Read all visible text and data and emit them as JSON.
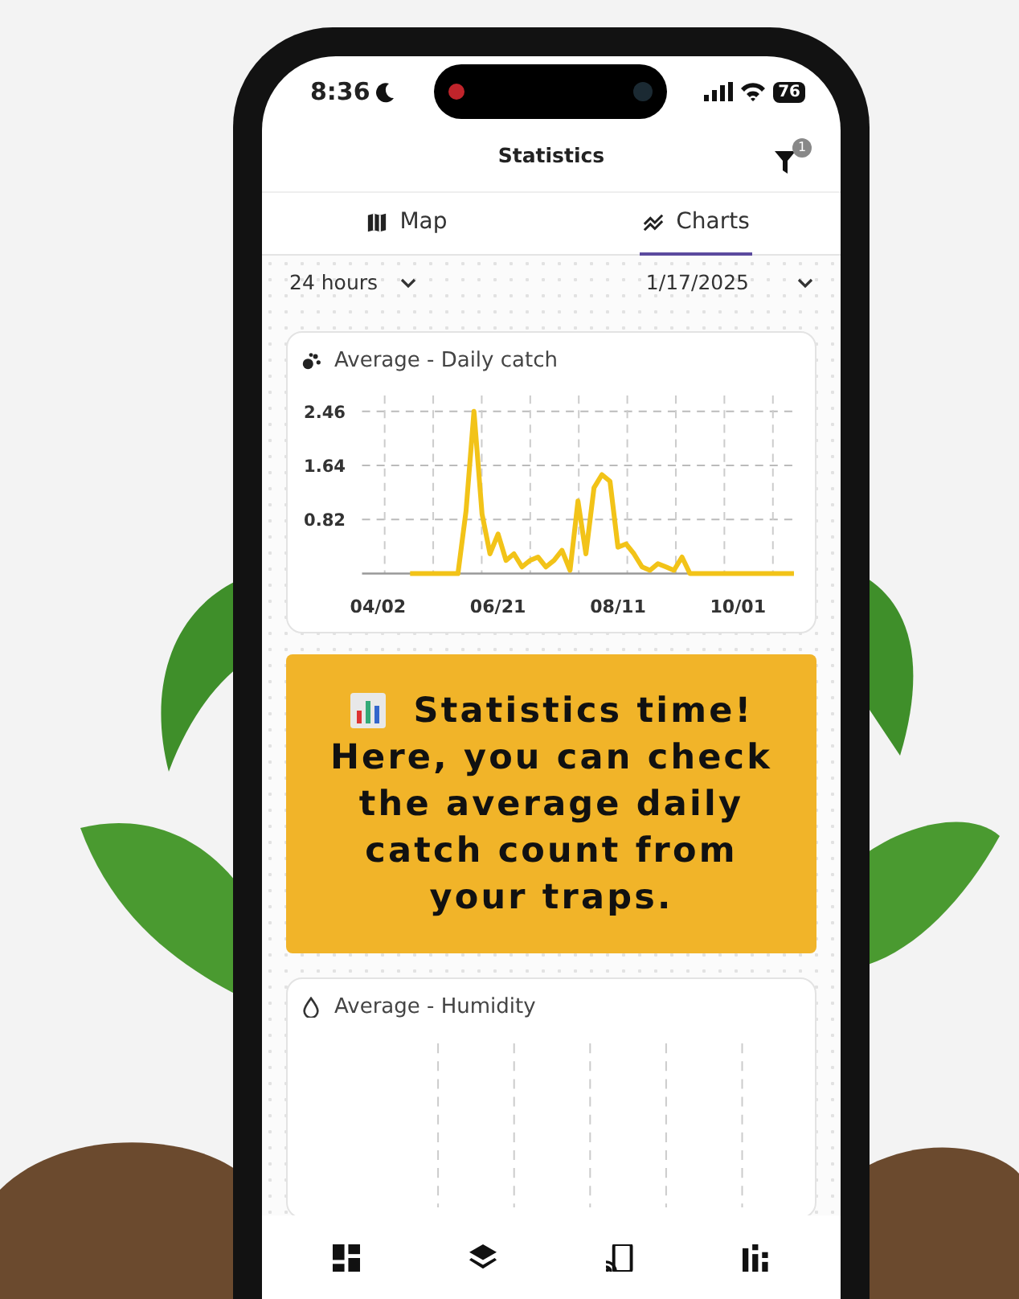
{
  "status_bar": {
    "time": "8:36",
    "battery": "76"
  },
  "header": {
    "title": "Statistics",
    "filter_badge": "1"
  },
  "tabs": [
    {
      "label": "Map",
      "selected": false
    },
    {
      "label": "Charts",
      "selected": true
    }
  ],
  "filters": {
    "period": "24 hours",
    "date": "1/17/2025"
  },
  "charts": [
    {
      "title": "Average - Daily catch",
      "chart_data": {
        "type": "line",
        "categories": [
          null,
          null,
          "04/02",
          null,
          null,
          null,
          null,
          null,
          null,
          null,
          null,
          null,
          null,
          null,
          null,
          null,
          null,
          "06/21",
          null,
          null,
          null,
          null,
          null,
          null,
          null,
          null,
          null,
          null,
          null,
          null,
          null,
          null,
          "08/11",
          null,
          null,
          null,
          null,
          null,
          null,
          null,
          null,
          null,
          null,
          null,
          null,
          null,
          null,
          "10/01",
          null,
          null,
          null,
          null,
          null,
          null,
          null
        ],
        "series": [
          {
            "color": "#f2c318",
            "values": [
              null,
              null,
              null,
              null,
              null,
              null,
              0,
              0,
              0,
              0,
              0,
              0,
              0,
              0.95,
              2.46,
              0.9,
              0.3,
              0.6,
              0.2,
              0.3,
              0.1,
              0.2,
              0.25,
              0.1,
              0.2,
              0.35,
              0.05,
              1.1,
              0.3,
              1.3,
              1.5,
              1.4,
              0.4,
              0.45,
              0.3,
              0.1,
              0.05,
              0.15,
              0.1,
              0.05,
              0.25,
              0,
              0,
              0,
              0,
              0,
              0,
              0,
              0,
              0,
              0,
              0,
              0,
              0,
              0
            ]
          }
        ],
        "ylim": [
          0,
          2.7
        ],
        "grid": true,
        "yticks": [
          {
            "value": 0.82,
            "label": "0.82"
          },
          {
            "value": 1.64,
            "label": "1.64"
          },
          {
            "value": 2.46,
            "label": "2.46"
          }
        ]
      }
    },
    {
      "title": "Average - Humidity"
    }
  ],
  "tip": {
    "heading": "Statistics time!",
    "text": "Here, you can check the average daily catch count from your traps."
  }
}
